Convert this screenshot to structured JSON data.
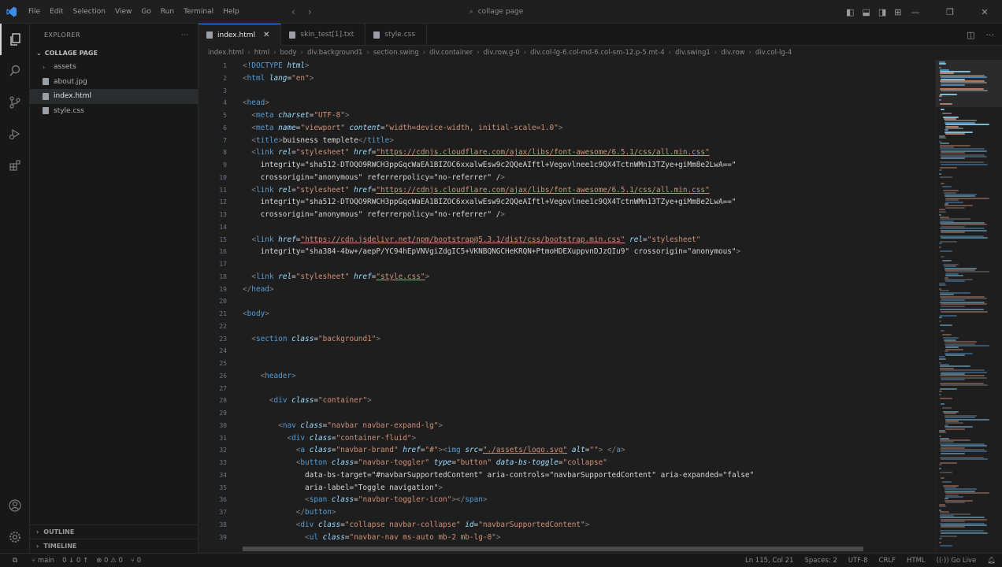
{
  "titlebar": {
    "menus": [
      "File",
      "Edit",
      "Selection",
      "View",
      "Go",
      "Run",
      "Terminal",
      "Help"
    ],
    "search_text": "collage page"
  },
  "sidebar": {
    "header": "EXPLORER",
    "folder": "COLLAGE PAGE",
    "items": [
      {
        "label": "assets",
        "type": "folder"
      },
      {
        "label": "about.jpg",
        "type": "file"
      },
      {
        "label": "index.html",
        "type": "file",
        "selected": true
      },
      {
        "label": "style.css",
        "type": "file"
      }
    ],
    "sections": [
      "OUTLINE",
      "TIMELINE"
    ]
  },
  "tabs": [
    {
      "label": "index.html",
      "active": true
    },
    {
      "label": "skin_test[1].txt",
      "active": false
    },
    {
      "label": "style.css",
      "active": false
    }
  ],
  "breadcrumb": [
    "index.html",
    "html",
    "body",
    "div.background1",
    "section.swing",
    "div.container",
    "div.row.g-0",
    "div.col-lg-6.col-md-6.col-sm-12.p-5.mt-4",
    "div.swing1",
    "div.row",
    "div.col-lg-4"
  ],
  "code_lines": [
    "<!DOCTYPE html>",
    "<html lang=\"en\">",
    "",
    "<head>",
    "  <meta charset=\"UTF-8\">",
    "  <meta name=\"viewport\" content=\"width=device-width, initial-scale=1.0\">",
    "  <title>buisness templete</title>",
    "  <link rel=\"stylesheet\" href=\"https://cdnjs.cloudflare.com/ajax/libs/font-awesome/6.5.1/css/all.min.css\"",
    "    integrity=\"sha512-DTOQO9RWCH3ppGqcWaEA1BIZOC6xxalwEsw9c2QQeAIftl+Vegovlnee1c9QX4TctnWMn13TZye+giMm8e2LwA==\"",
    "    crossorigin=\"anonymous\" referrerpolicy=\"no-referrer\" />",
    "  <link rel=\"stylesheet\" href=\"https://cdnjs.cloudflare.com/ajax/libs/font-awesome/6.5.1/css/all.min.css\"",
    "    integrity=\"sha512-DTOQO9RWCH3ppGqcWaEA1BIZOC6xxalwEsw9c2QQeAIftl+Vegovlnee1c9QX4TctnWMn13TZye+giMm8e2LwA==\"",
    "    crossorigin=\"anonymous\" referrerpolicy=\"no-referrer\" />",
    "",
    "  <link href=\"https://cdn.jsdelivr.net/npm/bootstrap@5.3.1/dist/css/bootstrap.min.css\" rel=\"stylesheet\"",
    "    integrity=\"sha384-4bw+/aepP/YC94hEpVNVgiZdgIC5+VKNBQNGCHeKRQN+PtmoHDEXuppvnDJzQIu9\" crossorigin=\"anonymous\">",
    "",
    "  <link rel=\"stylesheet\" href=\"style.css\">",
    "</head>",
    "",
    "<body>",
    "",
    "  <section class=\"background1\">",
    "",
    "",
    "    <header>",
    "",
    "      <div class=\"container\">",
    "",
    "        <nav class=\"navbar navbar-expand-lg\">",
    "          <div class=\"container-fluid\">",
    "            <a class=\"navbar-brand\" href=\"#\"><img src=\"./assets/logo.svg\" alt=\"\"> </a>",
    "            <button class=\"navbar-toggler\" type=\"button\" data-bs-toggle=\"collapse\"",
    "              data-bs-target=\"#navbarSupportedContent\" aria-controls=\"navbarSupportedContent\" aria-expanded=\"false\"",
    "              aria-label=\"Toggle navigation\">",
    "              <span class=\"navbar-toggler-icon\"></span>",
    "            </button>",
    "            <div class=\"collapse navbar-collapse\" id=\"navbarSupportedContent\">",
    "              <ul class=\"navbar-nav ms-auto mb-2 mb-lg-0\">"
  ],
  "statusbar": {
    "branch": "main",
    "sync": "0 ↓ 0 ↑",
    "problems": "⊗ 0 ⚠ 0",
    "ports": "⑂ 0",
    "position": "Ln 115, Col 21",
    "spaces": "Spaces: 2",
    "encoding": "UTF-8",
    "eol": "CRLF",
    "language": "HTML",
    "golive": "Go Live"
  },
  "colors": {
    "tag": "#569cd6",
    "attribute": "#9cdcfe",
    "string": "#ce9178",
    "accent": "#3b8eea"
  }
}
